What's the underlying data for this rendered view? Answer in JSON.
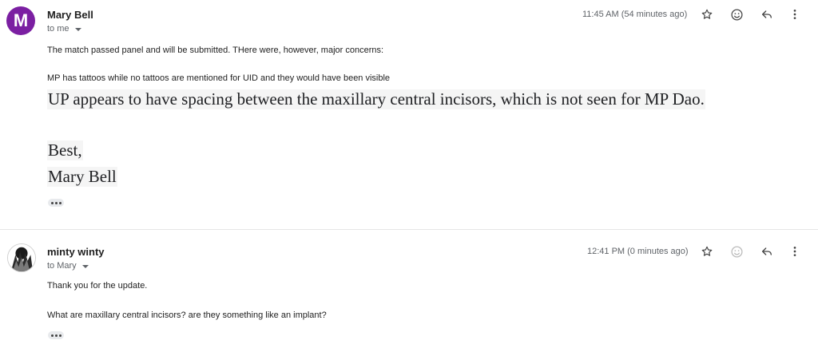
{
  "messages": [
    {
      "sender": "Mary Bell",
      "avatar_letter": "M",
      "to": "to me",
      "time": "11:45 AM (54 minutes ago)",
      "body": {
        "line1": "The match passed panel and will be submitted.  THere were, however, major concerns:",
        "line2": "MP has tattoos while no tattoos are mentioned for UID and they would have been visible",
        "line3": "UP appears to have spacing between the maxillary central incisors, which is not seen for MP Dao.",
        "signoff": "Best,",
        "signature": "Mary Bell"
      }
    },
    {
      "sender": "minty winty",
      "to": "to Mary",
      "time": "12:41 PM (0 minutes ago)",
      "body": {
        "line1": "Thank you for the update.",
        "line2": "What are maxillary central incisors? are they something like an implant?"
      }
    }
  ],
  "colors": {
    "avatar_bg": "#7b1fa2",
    "muted_text": "#5f6368",
    "body_text": "#222222"
  },
  "icons": [
    "star-icon",
    "emoji-icon",
    "reply-icon",
    "more-vert-icon"
  ]
}
